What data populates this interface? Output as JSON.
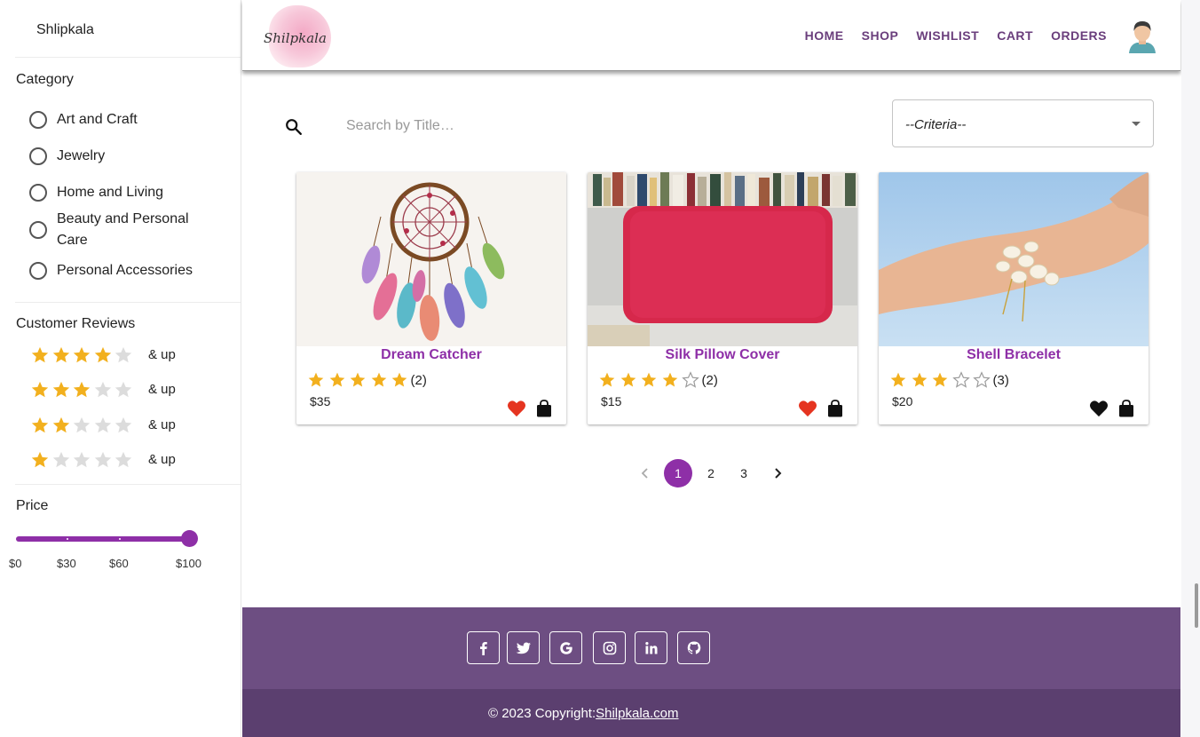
{
  "sidebar": {
    "brand": "Shlipkala",
    "category_title": "Category",
    "categories": [
      {
        "label": "Art and Craft"
      },
      {
        "label": "Jewelry"
      },
      {
        "label": "Home and Living"
      },
      {
        "label": "Beauty and Personal Care"
      },
      {
        "label": "Personal Accessories"
      }
    ],
    "reviews_title": "Customer Reviews",
    "review_filters": [
      {
        "stars": 4,
        "label": "& up"
      },
      {
        "stars": 3,
        "label": "& up"
      },
      {
        "stars": 2,
        "label": "& up"
      },
      {
        "stars": 1,
        "label": "& up"
      }
    ],
    "price_title": "Price",
    "price_slider": {
      "min": 0,
      "max": 100,
      "value": 100
    },
    "price_marks": [
      "$0",
      "$30",
      "$60",
      "$100"
    ]
  },
  "header": {
    "logo_text": "Shilpkala",
    "nav": [
      "HOME",
      "SHOP",
      "WISHLIST",
      "CART",
      "ORDERS"
    ]
  },
  "search": {
    "placeholder": "Search by Title…",
    "criteria": "--Criteria--"
  },
  "products": [
    {
      "title": "Dream Catcher",
      "rating": 5,
      "count": "(2)",
      "price": "$35",
      "wishlisted": true
    },
    {
      "title": "Silk Pillow Cover",
      "rating": 4,
      "count": "(2)",
      "price": "$15",
      "wishlisted": true
    },
    {
      "title": "Shell Bracelet",
      "rating": 3,
      "count": "(3)",
      "price": "$20",
      "wishlisted": false
    }
  ],
  "pagination": {
    "pages": [
      "1",
      "2",
      "3"
    ],
    "current": "1"
  },
  "footer": {
    "social": [
      "facebook-icon",
      "twitter-icon",
      "google-icon",
      "instagram-icon",
      "linkedin-icon",
      "github-icon"
    ],
    "copyright_prefix": "© 2023 Copyright:",
    "copyright_link": "Shilpkala.com"
  },
  "colors": {
    "accent": "#8e2fa7",
    "nav_text": "#6a3e7c",
    "star": "#f2b01e",
    "heart_active": "#e53420",
    "footer_top": "#6d4e82",
    "footer_bottom": "#5b3f6f"
  }
}
